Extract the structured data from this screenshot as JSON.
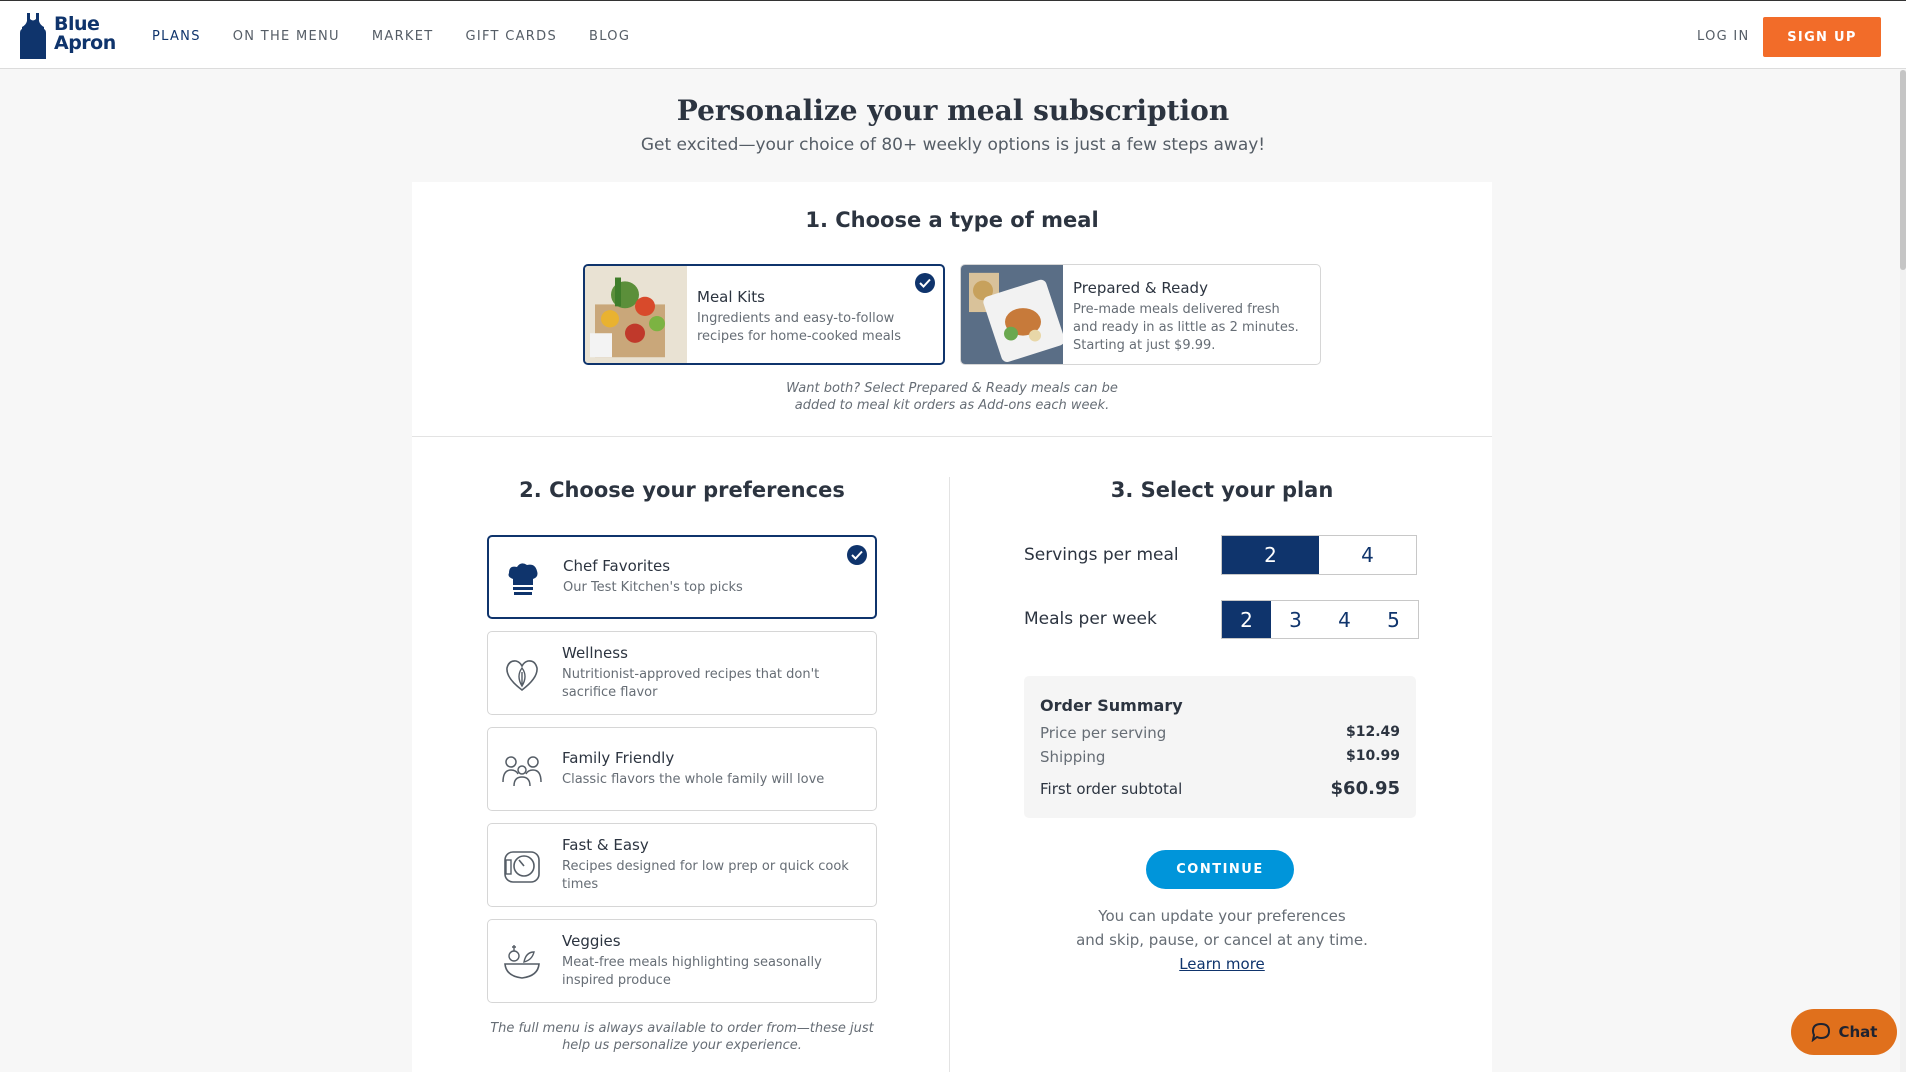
{
  "header": {
    "brand_line1": "Blue",
    "brand_line2": "Apron",
    "nav": [
      "PLANS",
      "ON THE MENU",
      "MARKET",
      "GIFT CARDS",
      "BLOG"
    ],
    "login": "LOG IN",
    "signup": "SIGN UP"
  },
  "page": {
    "title": "Personalize your meal subscription",
    "subtitle": "Get excited—your choice of 80+ weekly options is just a few steps away!"
  },
  "step1": {
    "title": "1. Choose a type of meal",
    "options": [
      {
        "name": "Meal Kits",
        "desc": "Ingredients and easy-to-follow recipes for home-cooked meals",
        "selected": true
      },
      {
        "name": "Prepared & Ready",
        "desc": "Pre-made meals delivered fresh and ready in as little as 2 minutes. Starting at just $9.99.",
        "selected": false
      }
    ],
    "note_line1": "Want both? Select Prepared & Ready meals can be",
    "note_line2": "added to meal kit orders as Add-ons each week."
  },
  "step2": {
    "title": "2. Choose your preferences",
    "options": [
      {
        "name": "Chef Favorites",
        "desc": "Our Test Kitchen's top picks",
        "icon": "chef-hat-icon",
        "selected": true
      },
      {
        "name": "Wellness",
        "desc": "Nutritionist-approved recipes that don't sacrifice flavor",
        "icon": "heart-leaf-icon",
        "selected": false
      },
      {
        "name": "Family Friendly",
        "desc": "Classic flavors the whole family will love",
        "icon": "family-icon",
        "selected": false
      },
      {
        "name": "Fast & Easy",
        "desc": "Recipes designed for low prep or quick cook times",
        "icon": "timer-icon",
        "selected": false
      },
      {
        "name": "Veggies",
        "desc": "Meat-free meals highlighting seasonally inspired produce",
        "icon": "veggie-bowl-icon",
        "selected": false
      }
    ],
    "note_line1": "The full menu is always available to order from—these just",
    "note_line2": "help us personalize your experience."
  },
  "step3": {
    "title": "3. Select your plan",
    "servings_label": "Servings per meal",
    "servings_options": [
      "2",
      "4"
    ],
    "servings_selected": "2",
    "meals_label": "Meals per week",
    "meals_options": [
      "2",
      "3",
      "4",
      "5"
    ],
    "meals_selected": "2",
    "summary": {
      "title": "Order Summary",
      "price_label": "Price per serving",
      "price_value": "$12.49",
      "shipping_label": "Shipping",
      "shipping_value": "$10.99",
      "subtotal_label": "First order subtotal",
      "subtotal_value": "$60.95"
    },
    "continue": "CONTINUE",
    "update_line1": "You can update your preferences",
    "update_line2": "and skip, pause, or cancel at any time.",
    "learn_more": "Learn more"
  },
  "chat": "Chat",
  "colors": {
    "brand_navy": "#0f346c",
    "signup_orange": "#f26c29",
    "continue_blue": "#0095da",
    "chat_orange": "#e0701c"
  }
}
